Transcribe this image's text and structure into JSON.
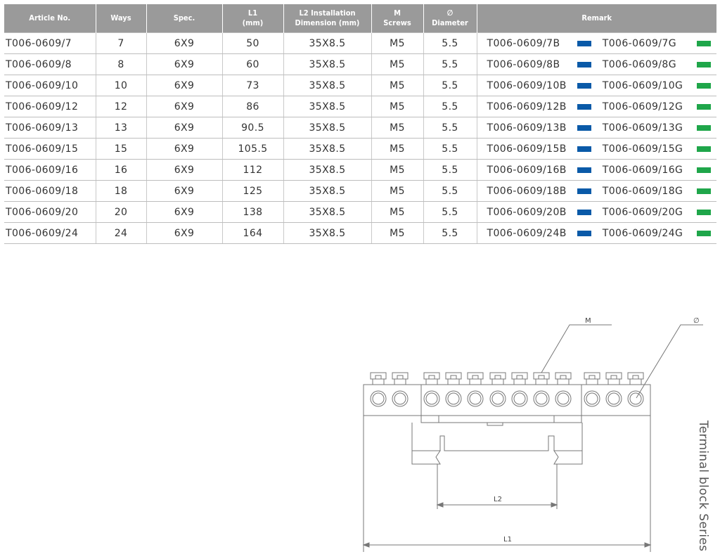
{
  "table": {
    "headers": {
      "article": "Article No.",
      "ways": "Ways",
      "spec": "Spec.",
      "l1_line1": "L1",
      "l1_line2": "(mm)",
      "l2_line1": "L2 Installation",
      "l2_line2": "Dimension (mm)",
      "m_line1": "M",
      "m_line2": "Screws",
      "d_line1": "∅",
      "d_line2": "Diameter",
      "remark": "Remark"
    },
    "rows": [
      {
        "article": "T006-0609/7",
        "ways": "7",
        "spec": "6X9",
        "l1": "50",
        "l2": "35X8.5",
        "m": "M5",
        "d": "5.5",
        "blue": "T006-0609/7B",
        "green": "T006-0609/7G"
      },
      {
        "article": "T006-0609/8",
        "ways": "8",
        "spec": "6X9",
        "l1": "60",
        "l2": "35X8.5",
        "m": "M5",
        "d": "5.5",
        "blue": "T006-0609/8B",
        "green": "T006-0609/8G"
      },
      {
        "article": "T006-0609/10",
        "ways": "10",
        "spec": "6X9",
        "l1": "73",
        "l2": "35X8.5",
        "m": "M5",
        "d": "5.5",
        "blue": "T006-0609/10B",
        "green": "T006-0609/10G"
      },
      {
        "article": "T006-0609/12",
        "ways": "12",
        "spec": "6X9",
        "l1": "86",
        "l2": "35X8.5",
        "m": "M5",
        "d": "5.5",
        "blue": "T006-0609/12B",
        "green": "T006-0609/12G"
      },
      {
        "article": "T006-0609/13",
        "ways": "13",
        "spec": "6X9",
        "l1": "90.5",
        "l2": "35X8.5",
        "m": "M5",
        "d": "5.5",
        "blue": "T006-0609/13B",
        "green": "T006-0609/13G"
      },
      {
        "article": "T006-0609/15",
        "ways": "15",
        "spec": "6X9",
        "l1": "105.5",
        "l2": "35X8.5",
        "m": "M5",
        "d": "5.5",
        "blue": "T006-0609/15B",
        "green": "T006-0609/15G"
      },
      {
        "article": "T006-0609/16",
        "ways": "16",
        "spec": "6X9",
        "l1": "112",
        "l2": "35X8.5",
        "m": "M5",
        "d": "5.5",
        "blue": "T006-0609/16B",
        "green": "T006-0609/16G"
      },
      {
        "article": "T006-0609/18",
        "ways": "18",
        "spec": "6X9",
        "l1": "125",
        "l2": "35X8.5",
        "m": "M5",
        "d": "5.5",
        "blue": "T006-0609/18B",
        "green": "T006-0609/18G"
      },
      {
        "article": "T006-0609/20",
        "ways": "20",
        "spec": "6X9",
        "l1": "138",
        "l2": "35X8.5",
        "m": "M5",
        "d": "5.5",
        "blue": "T006-0609/20B",
        "green": "T006-0609/20G"
      },
      {
        "article": "T006-0609/24",
        "ways": "24",
        "spec": "6X9",
        "l1": "164",
        "l2": "35X8.5",
        "m": "M5",
        "d": "5.5",
        "blue": "T006-0609/24B",
        "green": "T006-0609/24G"
      }
    ]
  },
  "colors": {
    "header_bg": "#9a9a9a",
    "blue_swatch": "#0a5aa8",
    "green_swatch": "#1fa64a"
  },
  "drawing": {
    "label_m": "M",
    "label_diameter": "∅",
    "label_l1": "L1",
    "label_l2": "L2"
  },
  "side_caption": "Terminal block Series"
}
